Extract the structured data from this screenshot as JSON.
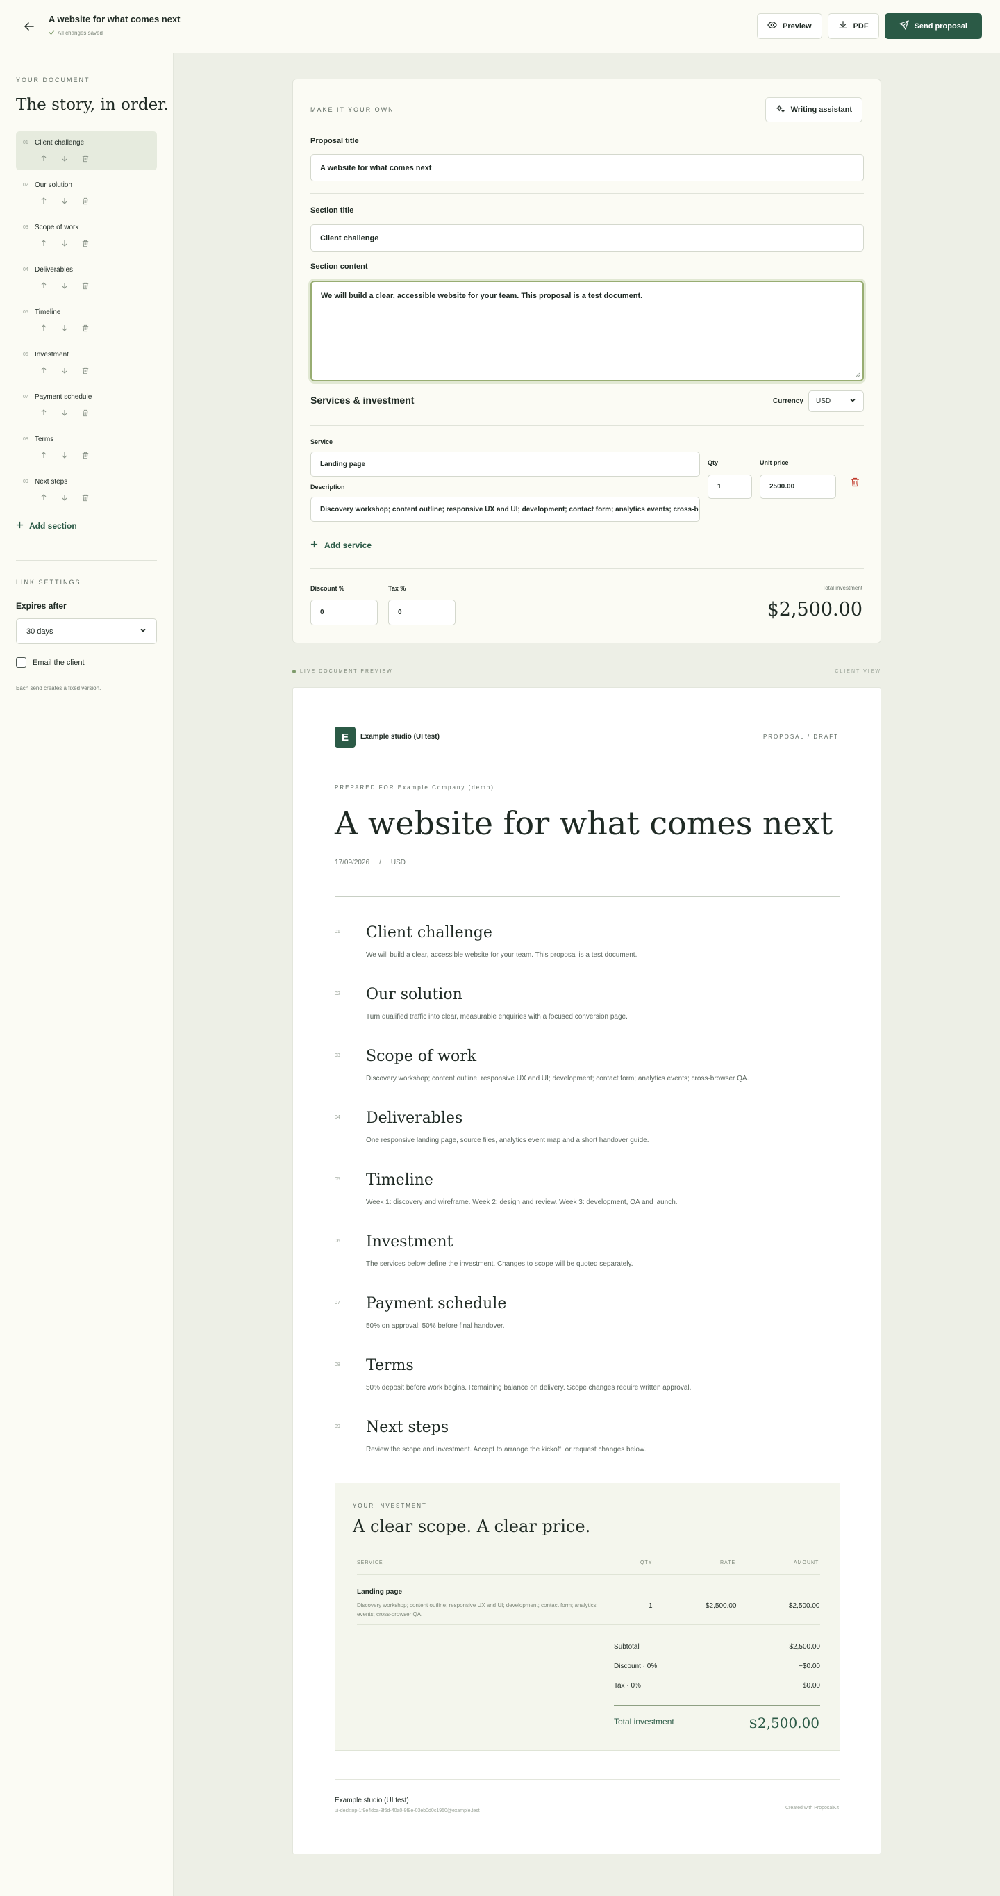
{
  "header": {
    "title": "A website for what comes next",
    "saved_status": "All changes saved",
    "preview_label": "Preview",
    "pdf_label": "PDF",
    "send_label": "Send proposal"
  },
  "sidebar": {
    "eyebrow": "YOUR DOCUMENT",
    "heading": "The story, in order.",
    "items": [
      {
        "num": "01",
        "label": "Client challenge"
      },
      {
        "num": "02",
        "label": "Our solution"
      },
      {
        "num": "03",
        "label": "Scope of work"
      },
      {
        "num": "04",
        "label": "Deliverables"
      },
      {
        "num": "05",
        "label": "Timeline"
      },
      {
        "num": "06",
        "label": "Investment"
      },
      {
        "num": "07",
        "label": "Payment schedule"
      },
      {
        "num": "08",
        "label": "Terms"
      },
      {
        "num": "09",
        "label": "Next steps"
      }
    ],
    "add_section": "Add section",
    "link_settings": "LINK SETTINGS",
    "expires_label": "Expires after",
    "expires_value": "30 days",
    "email_label": "Email the client",
    "send_note": "Each send creates a fixed version."
  },
  "editor": {
    "eyebrow": "MAKE IT YOUR OWN",
    "assistant": "Writing assistant",
    "proposal_title_label": "Proposal title",
    "proposal_title_value": "A website for what comes next",
    "section_title_label": "Section title",
    "section_title_value": "Client challenge",
    "section_content_label": "Section content",
    "section_content_value": "We will build a clear, accessible website for your team. This proposal is a test document.",
    "services_heading": "Services & investment",
    "currency_label": "Currency",
    "currency_value": "USD",
    "service_label": "Service",
    "service_value": "Landing page",
    "description_label": "Description",
    "description_value": "Discovery workshop; content outline; responsive UX and UI; development; contact form; analytics events; cross-browser QA.",
    "qty_label": "Qty",
    "qty_value": "1",
    "unit_price_label": "Unit price",
    "unit_price_value": "2500.00",
    "add_service": "Add service",
    "discount_label": "Discount %",
    "discount_value": "0",
    "tax_label": "Tax %",
    "tax_value": "0",
    "total_label": "Total investment",
    "total_value": "$2,500.00"
  },
  "preview": {
    "left_label": "LIVE DOCUMENT PREVIEW",
    "right_label": "CLIENT VIEW"
  },
  "document": {
    "logo_letter": "E",
    "studio": "Example studio (UI test)",
    "status": "PROPOSAL / DRAFT",
    "prepared_for": "PREPARED FOR Example Company (demo)",
    "title": "A website for what comes next",
    "date": "17/09/2026",
    "separator": "/",
    "currency": "USD",
    "sections": [
      {
        "num": "01",
        "title": "Client challenge",
        "body": "We will build a clear, accessible website for your team. This proposal is a test document."
      },
      {
        "num": "02",
        "title": "Our solution",
        "body": "Turn qualified traffic into clear, measurable enquiries with a focused conversion page."
      },
      {
        "num": "03",
        "title": "Scope of work",
        "body": "Discovery workshop; content outline; responsive UX and UI; development; contact form; analytics events; cross-browser QA."
      },
      {
        "num": "04",
        "title": "Deliverables",
        "body": "One responsive landing page, source files, analytics event map and a short handover guide."
      },
      {
        "num": "05",
        "title": "Timeline",
        "body": "Week 1: discovery and wireframe. Week 2: design and review. Week 3: development, QA and launch."
      },
      {
        "num": "06",
        "title": "Investment",
        "body": "The services below define the investment. Changes to scope will be quoted separately."
      },
      {
        "num": "07",
        "title": "Payment schedule",
        "body": "50% on approval; 50% before final handover."
      },
      {
        "num": "08",
        "title": "Terms",
        "body": "50% deposit before work begins. Remaining balance on delivery. Scope changes require written approval."
      },
      {
        "num": "09",
        "title": "Next steps",
        "body": "Review the scope and investment. Accept to arrange the kickoff, or request changes below."
      }
    ],
    "investment": {
      "eyebrow": "YOUR INVESTMENT",
      "title": "A clear scope. A clear price.",
      "col_service": "SERVICE",
      "col_qty": "QTY",
      "col_rate": "RATE",
      "col_amount": "AMOUNT",
      "row_service": "Landing page",
      "row_desc": "Discovery workshop; content outline; responsive UX and UI; development; contact form; analytics events; cross-browser QA.",
      "row_qty": "1",
      "row_rate": "$2,500.00",
      "row_amount": "$2,500.00",
      "subtotal_label": "Subtotal",
      "subtotal_value": "$2,500.00",
      "discount_label": "Discount · 0%",
      "discount_value": "−$0.00",
      "tax_label": "Tax · 0%",
      "tax_value": "$0.00",
      "total_label": "Total investment",
      "total_value": "$2,500.00"
    },
    "footer_studio": "Example studio (UI test)",
    "footer_email": "ui-desktop-1f9e4dca-8f6d-40a0-9f9e-03eb0d0c1950@example.test",
    "footer_credit": "Created with ProposalKit"
  },
  "colors": {
    "accent": "#2b5a46",
    "focus": "#98ad72",
    "danger": "#c0392b"
  }
}
